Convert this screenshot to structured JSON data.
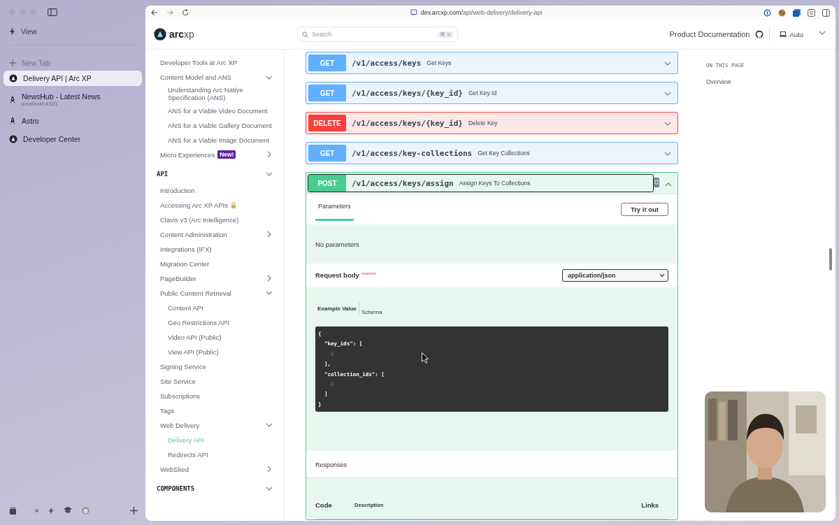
{
  "arc_sidebar": {
    "actions": [
      {
        "kind": "view",
        "label": "View"
      },
      {
        "kind": "new",
        "label": "New Tab"
      }
    ],
    "tabs": [
      {
        "title": "Delivery API | Arc XP",
        "kind": "arc",
        "selected": true
      },
      {
        "title": "NewsHub - Latest News",
        "subtitle": "localhost:4321",
        "kind": "rocket",
        "selected": false
      },
      {
        "title": "Astro",
        "kind": "rocket",
        "selected": false
      },
      {
        "title": "Developer Center",
        "kind": "arc",
        "selected": false
      }
    ]
  },
  "browser": {
    "url_host": "dev.arcxp.com",
    "url_path": "/api/web-delivery/delivery-api"
  },
  "header": {
    "logo_bold": "arc",
    "logo_light": "xp",
    "search": {
      "placeholder": "Search",
      "shortcut": "⌘ K"
    },
    "product_documentation": "Product Documentation",
    "theme": "Auto"
  },
  "nav": {
    "items": [
      {
        "label": "Developer Tools at Arc XP",
        "selected": false
      },
      {
        "label": "Content Model and ANS",
        "selected": false,
        "expanded": true,
        "children": [
          {
            "label": "Understanding Arc Native Specification (ANS)",
            "selected": false
          },
          {
            "label": "ANS for a Viable Video Document",
            "selected": false
          },
          {
            "label": "ANS for a Viable Gallery Document",
            "selected": false
          },
          {
            "label": "ANS for a Viable Image Document",
            "selected": false
          }
        ]
      },
      {
        "label": "Micro Experiences",
        "badge": "New!",
        "selected": false,
        "expanded": false
      }
    ],
    "sections": [
      {
        "title": "API",
        "expanded": true,
        "items": [
          {
            "label": "Introduction",
            "selected": false
          },
          {
            "label": "Accessing Arc XP APIs",
            "locked": true,
            "selected": false
          },
          {
            "label": "Clavis v3 (Arc Intelligence)",
            "selected": false
          },
          {
            "label": "Content Administration",
            "selected": false,
            "expanded": false
          },
          {
            "label": "Integrations (IFX)",
            "selected": false
          },
          {
            "label": "Migration Center",
            "selected": false
          },
          {
            "label": "PageBuilder",
            "selected": false,
            "expanded": false
          },
          {
            "label": "Public Content Retrieval",
            "selected": false,
            "expanded": true,
            "children": [
              {
                "label": "Content API",
                "selected": false
              },
              {
                "label": "Geo Restrictions API",
                "selected": false
              },
              {
                "label": "Video API (Public)",
                "selected": false
              },
              {
                "label": "View API (Public)",
                "selected": false
              }
            ]
          },
          {
            "label": "Signing Service",
            "selected": false
          },
          {
            "label": "Site Service",
            "selected": false
          },
          {
            "label": "Subscriptions",
            "selected": false
          },
          {
            "label": "Tags",
            "selected": false
          },
          {
            "label": "Web Delivery",
            "selected": false,
            "expanded": true,
            "children": [
              {
                "label": "Delivery API",
                "selected": true
              },
              {
                "label": "Redirects API",
                "selected": false
              }
            ]
          },
          {
            "label": "WebSked",
            "selected": false,
            "expanded": false
          }
        ]
      },
      {
        "title": "COMPONENTS",
        "expanded": true
      }
    ]
  },
  "operations": [
    {
      "kind": "get",
      "method": "GET",
      "path": "/v1/access/keys",
      "summary": "Get Keys",
      "expanded": false
    },
    {
      "kind": "get",
      "method": "GET",
      "path": "/v1/access/keys/{key_id}",
      "summary": "Get Key Id",
      "expanded": false
    },
    {
      "kind": "delete",
      "method": "DELETE",
      "path": "/v1/access/keys/{key_id}",
      "summary": "Delete Key",
      "expanded": false
    },
    {
      "kind": "get",
      "method": "GET",
      "path": "/v1/access/key-collections",
      "summary": "Get Key Collections",
      "expanded": false
    },
    {
      "kind": "post",
      "method": "POST",
      "path": "/v1/access/keys/assign",
      "summary": "Assign Keys To Collections",
      "expanded": true
    }
  ],
  "details": {
    "tabs": [
      {
        "label": "Parameters",
        "selected": true
      }
    ],
    "try_button": "Try it out",
    "no_parameters": "No parameters",
    "request_body": {
      "label": "Request body",
      "required": "required",
      "content_type": "application/json"
    },
    "example_tabs": [
      {
        "label": "Example Value",
        "selected": true
      },
      {
        "label": "Schema",
        "selected": false
      }
    ],
    "code": [
      {
        "kind": "plain",
        "text": "{"
      },
      {
        "kind": "plain",
        "text": "  \"key_ids\": ["
      },
      {
        "kind": "number",
        "text": "    0"
      },
      {
        "kind": "plain",
        "text": "  ],"
      },
      {
        "kind": "plain",
        "text": "  \"collection_ids\": ["
      },
      {
        "kind": "number",
        "text": "    0"
      },
      {
        "kind": "plain",
        "text": "  ]"
      },
      {
        "kind": "plain",
        "text": "}"
      }
    ],
    "responses": {
      "title": "Responses",
      "columns": [
        "Code",
        "Description",
        "Links"
      ]
    }
  },
  "on_this_page": {
    "title": "ON THIS PAGE",
    "items": [
      {
        "label": "Overview",
        "selected": false
      }
    ]
  }
}
